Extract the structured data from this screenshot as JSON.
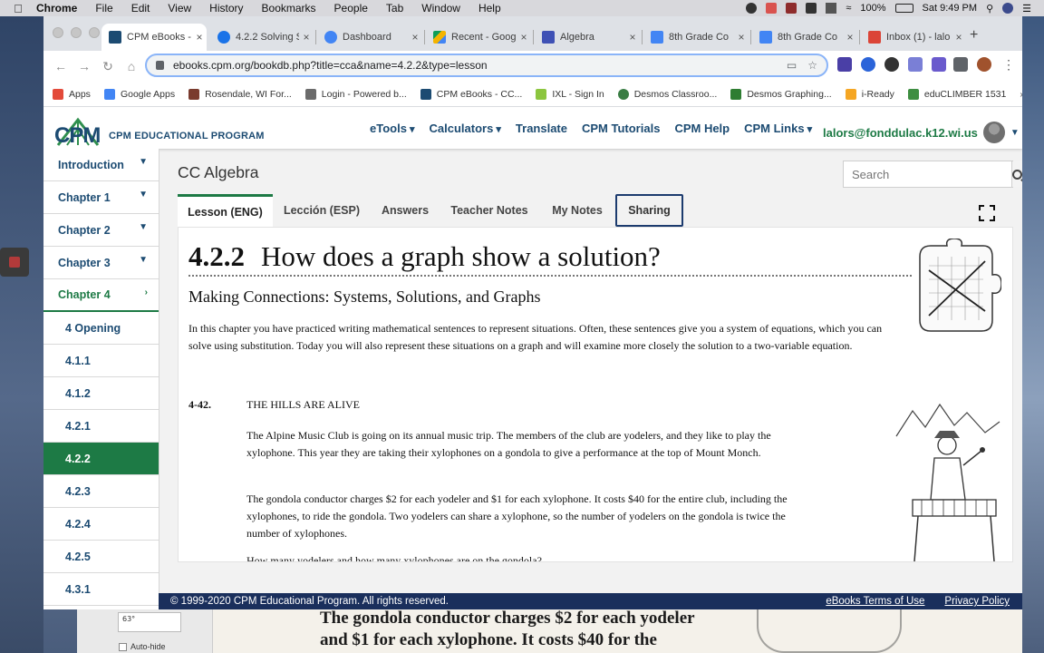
{
  "menubar": {
    "app": "Chrome",
    "items": [
      "File",
      "Edit",
      "View",
      "History",
      "Bookmarks",
      "People",
      "Tab",
      "Window",
      "Help"
    ],
    "battery": "100%",
    "clock": "Sat 9:49 PM"
  },
  "browser": {
    "tabs": [
      {
        "title": "CPM eBooks -",
        "favicon_color": "#1c4b72"
      },
      {
        "title": "4.2.2 Solving S",
        "favicon_color": "#1a73e8"
      },
      {
        "title": "Dashboard",
        "favicon_color": "#4285f4"
      },
      {
        "title": "Recent - Goog",
        "favicon_color": "#0f9d58"
      },
      {
        "title": "Algebra",
        "favicon_color": "#3f51b5"
      },
      {
        "title": "8th Grade Co",
        "favicon_color": "#4285f4"
      },
      {
        "title": "8th Grade Co",
        "favicon_color": "#4285f4"
      },
      {
        "title": "Inbox (1) - lalo",
        "favicon_color": "#db4437"
      }
    ],
    "url": "ebooks.cpm.org/bookdb.php?title=cca&name=4.2.2&type=lesson",
    "bookmarks": [
      {
        "label": "Apps",
        "color": "#777777"
      },
      {
        "label": "Google Apps",
        "color": "#4285f4"
      },
      {
        "label": "Rosendale, WI For...",
        "color": "#7a3b2e"
      },
      {
        "label": "Login - Powered b...",
        "color": "#6b6b6b"
      },
      {
        "label": "CPM eBooks - CC...",
        "color": "#1c4b72"
      },
      {
        "label": "IXL - Sign In",
        "color": "#8cc63f"
      },
      {
        "label": "Desmos Classroo...",
        "color": "#3a7d44"
      },
      {
        "label": "Desmos Graphing...",
        "color": "#2e7d32"
      },
      {
        "label": "i-Ready",
        "color": "#f5a623"
      },
      {
        "label": "eduCLIMBER 1531",
        "color": "#3e8e41"
      }
    ]
  },
  "site": {
    "logo_text": "CPM",
    "logo_subtitle": "CPM EDUCATIONAL PROGRAM",
    "nav": [
      "eTools",
      "Calculators",
      "Translate",
      "CPM Tutorials",
      "CPM Help",
      "CPM Links"
    ],
    "user": "lalors@fonddulac.k12.wi.us",
    "accent": "#1d7a45",
    "brand_blue": "#1c4b72"
  },
  "sidebar": [
    {
      "label": "Introduction",
      "chevron": "down"
    },
    {
      "label": "Chapter 1",
      "chevron": "down"
    },
    {
      "label": "Chapter 2",
      "chevron": "down"
    },
    {
      "label": "Chapter 3",
      "chevron": "down"
    },
    {
      "label": "Chapter 4",
      "chevron": "right"
    },
    {
      "label": "4 Opening"
    },
    {
      "label": "4.1.1"
    },
    {
      "label": "4.1.2"
    },
    {
      "label": "4.2.1"
    },
    {
      "label": "4.2.2"
    },
    {
      "label": "4.2.3"
    },
    {
      "label": "4.2.4"
    },
    {
      "label": "4.2.5"
    },
    {
      "label": "4.3.1"
    }
  ],
  "content": {
    "course_title": "CC Algebra",
    "search_placeholder": "Search",
    "tabs": [
      "Lesson (ENG)",
      "Lección (ESP)",
      "Answers",
      "Teacher Notes",
      "My Notes",
      "Sharing"
    ],
    "lesson_number": "4.2.2",
    "lesson_question": "How does a graph show a solution?",
    "subheading": "Making Connections: Systems, Solutions, and Graphs",
    "intro": "In this chapter you have practiced writing mathematical sentences to represent situations.  Often, these sentences give you a system of equations, which you can solve using substitution.  Today you will also represent these situations on a graph and will examine more closely the solution to a two-variable equation.",
    "problem_number": "4-42.",
    "problem_title": "THE HILLS ARE ALIVE",
    "paragraph1": "The Alpine Music Club is going on its annual music trip.  The members of the club are yodelers, and they like to play the xylophone.  This year they are taking their xylophones on a gondola to give a performance at the top of Mount Monch.",
    "paragraph2": "The gondola conductor charges $2 for each yodeler and $1 for each xylophone.  It costs $40 for the entire club, including the xylophones, to ride the gondola.  Two yodelers can share a xylophone, so the number of yodelers on the gondola is twice the number of xylophones.",
    "paragraph3": "How many yodelers and how many xylophones are on the gondola?"
  },
  "footer": {
    "copyright": "© 1999-2020 CPM Educational Program. All rights reserved.",
    "links": [
      "eBooks Terms of Use",
      "Privacy Policy"
    ]
  },
  "background_app": {
    "thumb_label": "63°",
    "autohide": "Auto-hide",
    "text_line1": "The gondola conductor charges $2 for each yodeler",
    "text_line2": "and $1 for each xylophone.  It costs $40 for the"
  }
}
